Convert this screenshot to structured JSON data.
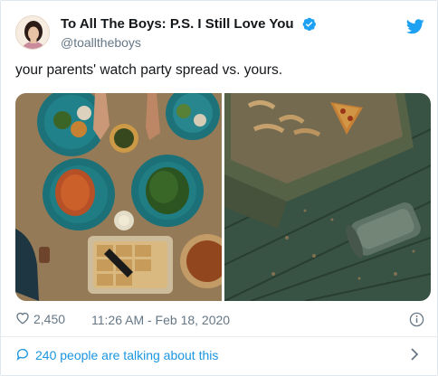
{
  "account": {
    "display_name": "To All The Boys: P.S. I Still Love You",
    "handle": "@toalltheboys",
    "verified_icon": "verified-badge-icon",
    "platform_icon": "twitter-bird-icon"
  },
  "tweet": {
    "text": "your parents' watch party spread vs. yours."
  },
  "meta": {
    "likes": "2,450",
    "timestamp": "11:26 AM - Feb 18, 2020"
  },
  "footer": {
    "conversation_text": "240 people are talking about this"
  },
  "colors": {
    "accent": "#1da1f2",
    "link": "#1b95e0",
    "muted": "#657786",
    "text": "#14171a"
  }
}
